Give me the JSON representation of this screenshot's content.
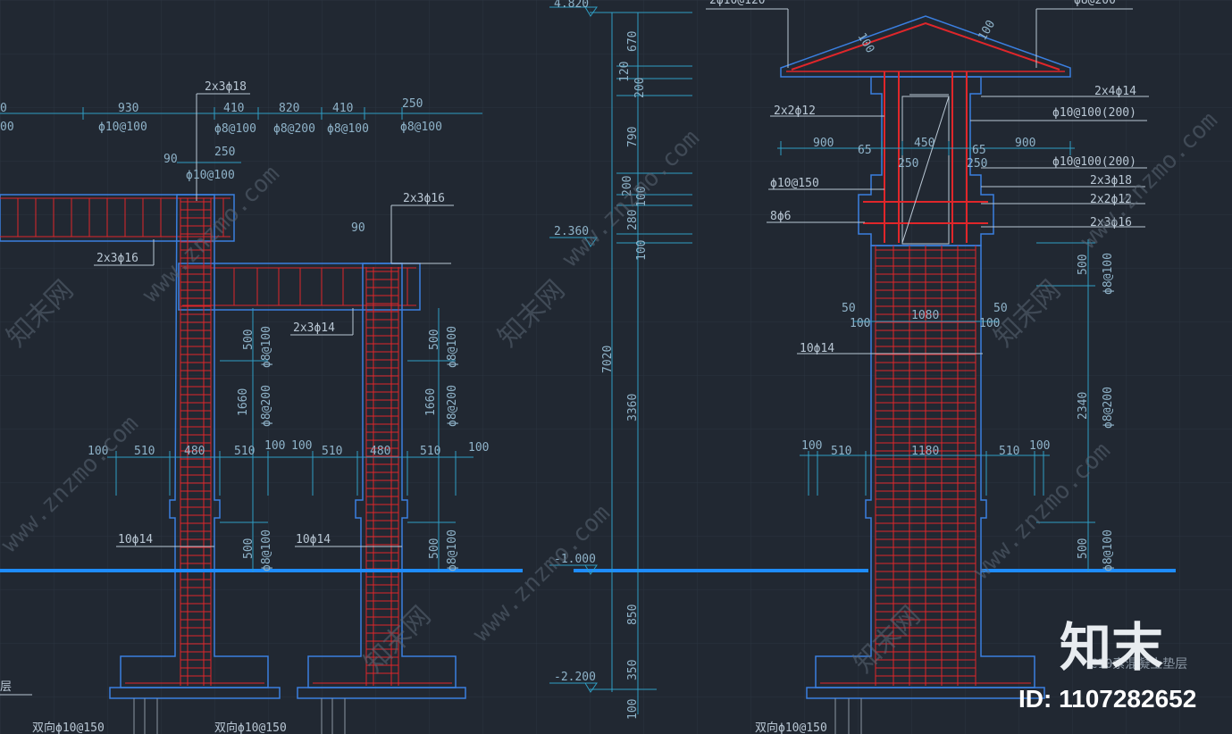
{
  "colors": {
    "background": "#212832",
    "grid": "#2b3440",
    "outline": "#3a7fe0",
    "rebar": "#e0262a",
    "dimension": "#2f9ec4",
    "ground": "#1e8cff",
    "text": "#b9c7d4"
  },
  "left_top_dims": {
    "partial_top": "0",
    "partial_bottom": "00",
    "d930": "930",
    "phi10at100": "ϕ10@100",
    "d410a": "410",
    "phi8at100a": "ϕ8@100",
    "d820": "820",
    "phi8at200": "ϕ8@200",
    "d410b": "410",
    "phi8at100b": "ϕ8@100",
    "d250a": "250",
    "phi8at100c": "ϕ8@100",
    "d90a": "90",
    "d250b": "250",
    "phi10at100b": "ϕ10@100",
    "d90b": "90"
  },
  "left_labels": {
    "bar_2x3_18": "2x3ϕ18",
    "bar_2x3_16a": "2x3ϕ16",
    "bar_2x3_16b": "2x3ϕ16",
    "bar_2x3_14": "2x3ϕ14",
    "bar_10_14a": "10ϕ14",
    "bar_10_14b": "10ϕ14",
    "layer": "层",
    "bottom_a": "双向ϕ10@150",
    "bottom_b": "双向ϕ10@150"
  },
  "left_mid_dims": {
    "d500a": "500",
    "p8at100a": "ϕ8@100",
    "d1660a": "1660",
    "p8at200a": "ϕ8@200",
    "d500b": "500",
    "p8at100b": "ϕ8@100",
    "d1660b": "1660",
    "p8at200b": "ϕ8@200",
    "d500c": "500",
    "p8at100c": "ϕ8@100",
    "d500d": "500",
    "p8at100d": "ϕ8@100"
  },
  "left_row_dims": [
    "100",
    "510",
    "480",
    "510",
    "100",
    "100",
    "510",
    "480",
    "510",
    "100"
  ],
  "middle": {
    "elev_top": "4.820",
    "elev_2360": "2.360",
    "elev_m1000": "-1.000",
    "elev_m2200": "-2.200",
    "dims": [
      "670",
      "120",
      "200",
      "790",
      "200",
      "100",
      "280",
      "100",
      "7020",
      "3360",
      "850",
      "350",
      "100"
    ]
  },
  "right_labels": {
    "top_left": "2ϕ10@120",
    "top_right": "ϕ8@200",
    "roof_a": "100",
    "roof_b": "100",
    "b2x4_14": "2x4ϕ14",
    "b2x2_12a": "2x2ϕ12",
    "p10at100_200a": "ϕ10@100(200)",
    "p10at100_200b": "ϕ10@100(200)",
    "b2x3_18": "2x3ϕ18",
    "b2x2_12b": "2x2ϕ12",
    "b2x3_16": "2x3ϕ16",
    "p10at150": "ϕ10@150",
    "b8_6": "8ϕ6",
    "b10_14": "10ϕ14",
    "bottom": "双向ϕ10@150"
  },
  "right_dims": {
    "d900a": "900",
    "d65a": "65",
    "d450": "450",
    "d65b": "65",
    "d900b": "900",
    "d250a": "250",
    "d250b": "250",
    "d50a": "50",
    "d100a": "100",
    "d1080": "1080",
    "d100b": "100",
    "d50b": "50",
    "d100c": "100",
    "d510a": "510",
    "d1180": "1180",
    "d510b": "510",
    "d100d": "100",
    "d500a": "500",
    "p8at100a": "ϕ8@100",
    "d2340": "2340",
    "p8at200": "ϕ8@200",
    "d500b": "500",
    "p8at100b": "ϕ8@100"
  },
  "watermark": {
    "url": "www.znzmo.com",
    "cn": "知末网",
    "logo": "知末",
    "concrete_note": "C10素混凝土垫层",
    "id": "ID: 1107282652"
  }
}
